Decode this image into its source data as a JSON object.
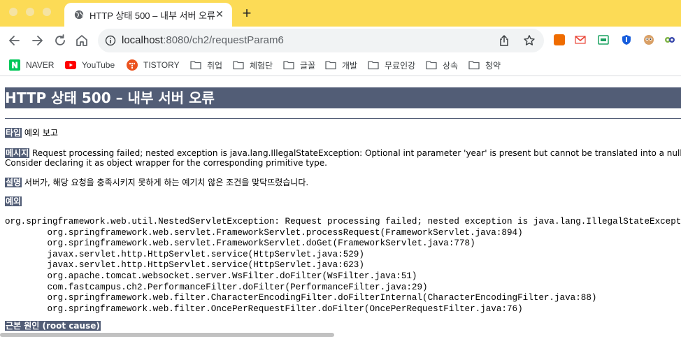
{
  "tab": {
    "title": "HTTP 상태 500 – 내부 서버 오류",
    "close_glyph": "✕",
    "new_tab_glyph": "+"
  },
  "toolbar": {
    "url_host": "localhost",
    "url_rest": ":8080/ch2/requestParam6"
  },
  "bookmarks": [
    {
      "label": "NAVER",
      "icon": "naver-icon"
    },
    {
      "label": "YouTube",
      "icon": "youtube-icon"
    },
    {
      "label": "TISTORY",
      "icon": "tistory-icon"
    },
    {
      "label": "취업",
      "icon": "folder-icon"
    },
    {
      "label": "체험단",
      "icon": "folder-icon"
    },
    {
      "label": "글꼴",
      "icon": "folder-icon"
    },
    {
      "label": "개발",
      "icon": "folder-icon"
    },
    {
      "label": "무료인강",
      "icon": "folder-icon"
    },
    {
      "label": "상속",
      "icon": "folder-icon"
    },
    {
      "label": "청약",
      "icon": "folder-icon"
    }
  ],
  "colors": {
    "tab_strip": "#fcdb56",
    "header_bg": "#525d76",
    "naver": "#03c75a",
    "youtube": "#ff0000",
    "tistory": "#eb531f"
  },
  "page": {
    "heading": "HTTP 상태 500 – 내부 서버 오류",
    "type_label": "타입",
    "type_value": "예외 보고",
    "message_label": "메시지",
    "message_value": "Request processing failed; nested exception is java.lang.IllegalStateException: Optional int parameter 'year' is present but cannot be translated into a null value due to being declared as a primitive type.",
    "message_value_2": "Consider declaring it as object wrapper for the corresponding primitive type.",
    "desc_label": "설명",
    "desc_value": "서버가, 해당 요청을 충족시키지 못하게 하는 예기치 않은 조건을 맞닥뜨렸습니다.",
    "exception_label": "예외",
    "stack_trace": "org.springframework.web.util.NestedServletException: Request processing failed; nested exception is java.lang.IllegalStateException\n\torg.springframework.web.servlet.FrameworkServlet.processRequest(FrameworkServlet.java:894)\n\torg.springframework.web.servlet.FrameworkServlet.doGet(FrameworkServlet.java:778)\n\tjavax.servlet.http.HttpServlet.service(HttpServlet.java:529)\n\tjavax.servlet.http.HttpServlet.service(HttpServlet.java:623)\n\torg.apache.tomcat.websocket.server.WsFilter.doFilter(WsFilter.java:51)\n\tcom.fastcampus.ch2.PerformanceFilter.doFilter(PerformanceFilter.java:29)\n\torg.springframework.web.filter.CharacterEncodingFilter.doFilterInternal(CharacterEncodingFilter.java:88)\n\torg.springframework.web.filter.OncePerRequestFilter.doFilter(OncePerRequestFilter.java:76)",
    "root_cause_label": "근본 원인 (root cause)"
  }
}
